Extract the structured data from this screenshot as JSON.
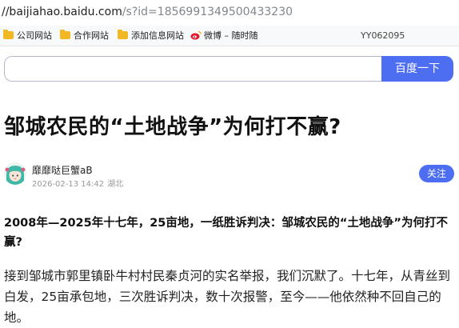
{
  "address_bar": {
    "host": "//baijiahao.baidu.com",
    "path": "/s?id=1856991349500433230"
  },
  "bookmarks": {
    "items": [
      {
        "label": "公司网站",
        "icon": "folder-icon"
      },
      {
        "label": "合作网站",
        "icon": "folder-icon"
      },
      {
        "label": "添加信息网站",
        "icon": "folder-icon"
      },
      {
        "label": "微博 – 随时随",
        "icon": "weibo-icon"
      }
    ],
    "tag": "YY062095"
  },
  "search": {
    "value": "",
    "button_label": "百度一下"
  },
  "article": {
    "title": "邹城农民的“土地战争”为何打不赢?",
    "author": {
      "name": "靡靡哒巨蟹aB",
      "date": "2026-02-13 14:42",
      "location": "湖北",
      "follow_label": "关注"
    },
    "lead": "2008年—2025年十七年，25亩地，一纸胜诉判决：邹城农民的“土地战争”为何打不赢?",
    "paragraph": "接到邹城市郭里镇卧牛村村民秦贞河的实名举报，我们沉默了。十七年，从青丝到白发，25亩承包地，三次胜诉判决，数十次报警，至今——他依然种不回自己的地。"
  },
  "colors": {
    "accent": "#4e6ef2",
    "folder": "#f2b824"
  }
}
